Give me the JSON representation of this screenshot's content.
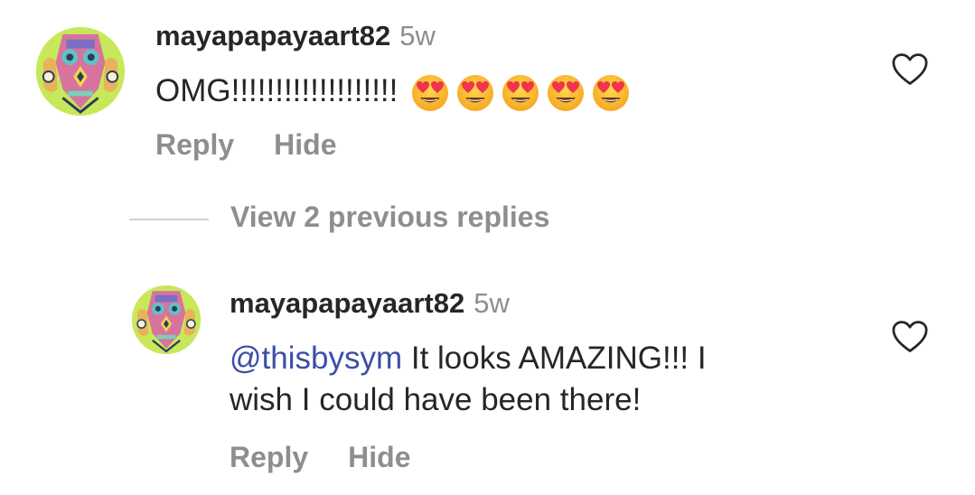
{
  "comments": [
    {
      "username": "mayapapayaart82",
      "time": "5w",
      "text": "OMG!!!!!!!!!!!!!!!!!!!",
      "emoji_count": 5,
      "emoji_name": "heart-eyes-emoji",
      "reply_label": "Reply",
      "hide_label": "Hide"
    },
    {
      "username": "mayapapayaart82",
      "time": "5w",
      "mention": "@thisbysym",
      "text_line1": " It looks AMAZING!!! I",
      "text_line2": "wish I could have been there!",
      "reply_label": "Reply",
      "hide_label": "Hide"
    }
  ],
  "view_replies_label": "View 2 previous replies",
  "colors": {
    "username": "#262626",
    "muted": "#8e8e8e",
    "mention": "#3d4ea8",
    "avatar_bg": "#c7e85a"
  },
  "icons": {
    "like": "heart-outline-icon",
    "avatar": "tribal-mask-avatar"
  }
}
